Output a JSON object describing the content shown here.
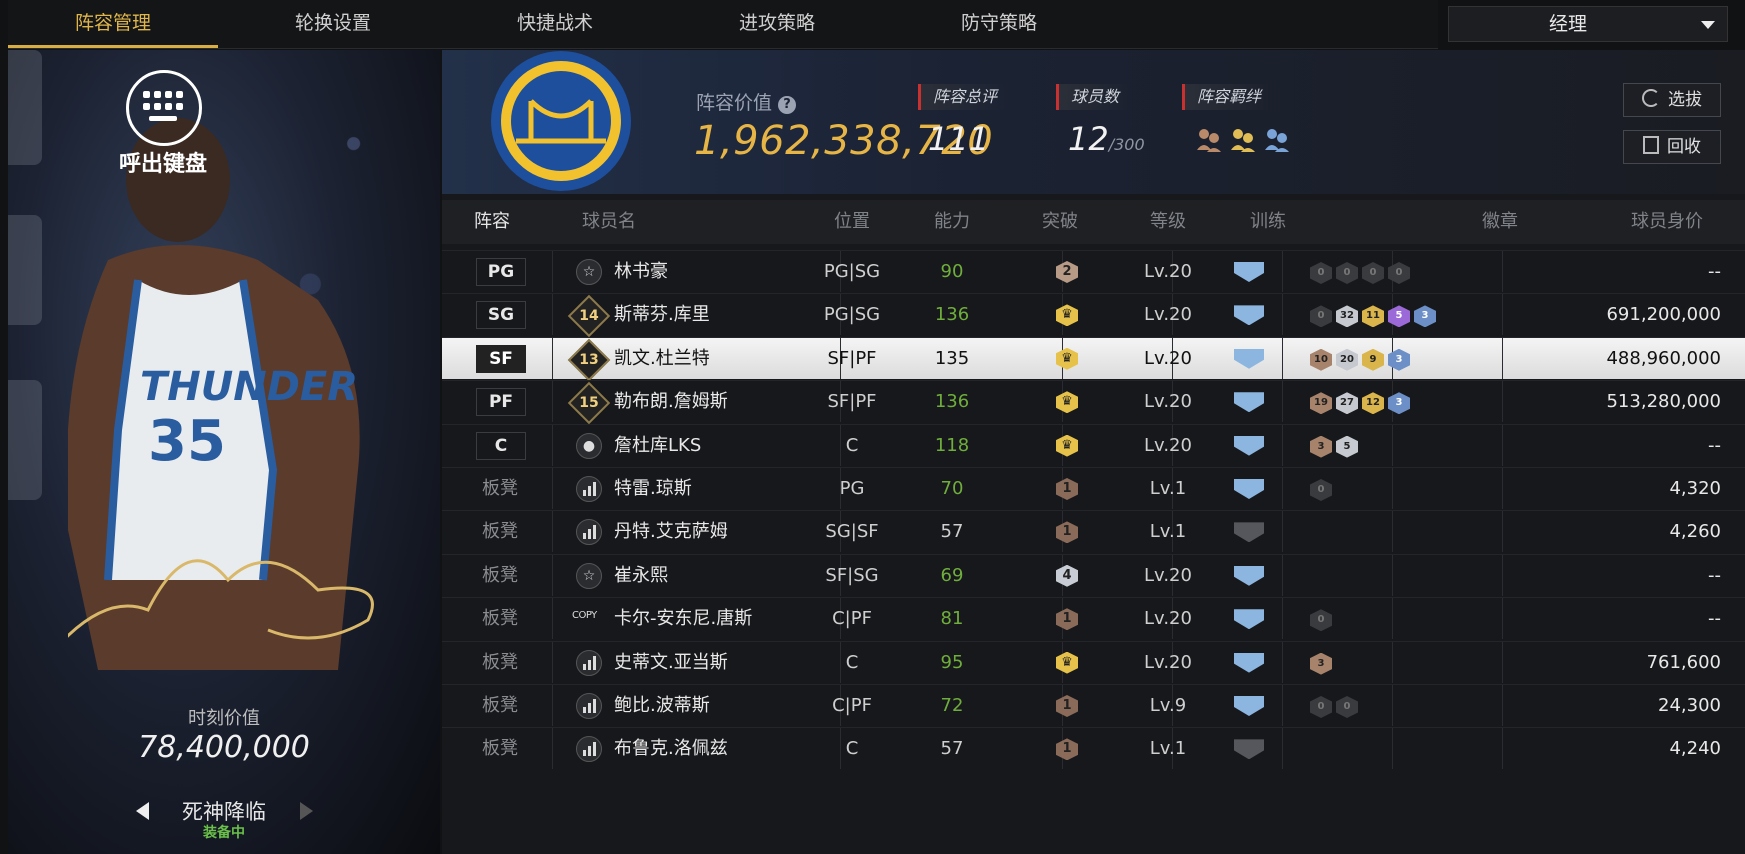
{
  "tabs": [
    "阵容管理",
    "轮换设置",
    "快捷战术",
    "进攻策略",
    "防守策略"
  ],
  "manager_select": "经理",
  "left_panel": {
    "keyboard_label": "呼出键盘",
    "moment_value_label": "时刻价值",
    "moment_value": "78,400,000",
    "skill_name": "死神降临",
    "skill_status": "装备中"
  },
  "header": {
    "value_label": "阵容价值",
    "value_help": "?",
    "value": "1,962,338,720",
    "rating_label": "阵容总评",
    "rating": "111",
    "players_label": "球员数",
    "players": "12",
    "players_max": "/300",
    "bond_label": "阵容羁绊",
    "select_button": "选拔",
    "recycle_button": "回收"
  },
  "columns": [
    "阵容",
    "球员名",
    "位置",
    "能力",
    "突破",
    "等级",
    "训练",
    "徽章",
    "球员身价"
  ],
  "rows": [
    {
      "slot": "PG",
      "bench": false,
      "icon": "star",
      "name": "林书豪",
      "pos": "PG|SG",
      "ability": "90",
      "green": true,
      "breakthrough": "2",
      "bk": "b2",
      "level": "Lv.20",
      "train": true,
      "badges": [
        [
          "0",
          "e"
        ],
        [
          "0",
          "e"
        ],
        [
          "0",
          "e"
        ],
        [
          "0",
          "e"
        ]
      ],
      "price": "--"
    },
    {
      "slot": "SG",
      "bench": false,
      "icon": "num",
      "num": "14",
      "name": "斯蒂芬.库里",
      "pos": "PG|SG",
      "ability": "136",
      "green": true,
      "breakthrough": "crown",
      "bk": "crown",
      "level": "Lv.20",
      "train": true,
      "badges": [
        [
          "0",
          "e"
        ],
        [
          "32",
          "sv"
        ],
        [
          "11",
          "gd"
        ],
        [
          "5",
          "pu"
        ],
        [
          "3",
          "bl"
        ]
      ],
      "price": "691,200,000"
    },
    {
      "slot": "SF",
      "bench": false,
      "selected": true,
      "icon": "num",
      "num": "13",
      "name": "凯文.杜兰特",
      "pos": "SF|PF",
      "ability": "135",
      "green": false,
      "breakthrough": "crown",
      "bk": "crown",
      "level": "Lv.20",
      "train": true,
      "badges": [
        [
          "10",
          "br"
        ],
        [
          "20",
          "sv"
        ],
        [
          "9",
          "gd"
        ],
        [
          "3",
          "bl"
        ]
      ],
      "price": "488,960,000"
    },
    {
      "slot": "PF",
      "bench": false,
      "icon": "num",
      "num": "15",
      "name": "勒布朗.詹姆斯",
      "pos": "SF|PF",
      "ability": "136",
      "green": true,
      "breakthrough": "crown",
      "bk": "crown",
      "level": "Lv.20",
      "train": true,
      "badges": [
        [
          "19",
          "br"
        ],
        [
          "27",
          "sv"
        ],
        [
          "12",
          "gd"
        ],
        [
          "3",
          "bl"
        ]
      ],
      "price": "513,280,000"
    },
    {
      "slot": "C",
      "bench": false,
      "icon": "person",
      "name": "詹杜库LKS",
      "pos": "C",
      "ability": "118",
      "green": true,
      "breakthrough": "crown",
      "bk": "crown",
      "level": "Lv.20",
      "train": true,
      "badges": [
        [
          "3",
          "br"
        ],
        [
          "5",
          "sv"
        ]
      ],
      "price": "--"
    },
    {
      "slot": "板凳",
      "bench": true,
      "icon": "bars",
      "name": "特雷.琼斯",
      "pos": "PG",
      "ability": "70",
      "green": true,
      "breakthrough": "1",
      "bk": "b1",
      "level": "Lv.1",
      "train": true,
      "badges": [
        [
          "0",
          "e"
        ]
      ],
      "price": "4,320"
    },
    {
      "slot": "板凳",
      "bench": true,
      "icon": "bars",
      "name": "丹特.艾克萨姆",
      "pos": "SG|SF",
      "ability": "57",
      "green": false,
      "breakthrough": "1",
      "bk": "b1",
      "level": "Lv.1",
      "train": false,
      "badges": [],
      "price": "4,260"
    },
    {
      "slot": "板凳",
      "bench": true,
      "icon": "star",
      "name": "崔永熙",
      "pos": "SF|SG",
      "ability": "69",
      "green": true,
      "breakthrough": "4",
      "bk": "b4",
      "level": "Lv.20",
      "train": true,
      "badges": [],
      "price": "--"
    },
    {
      "slot": "板凳",
      "bench": true,
      "icon": "copy",
      "name": "卡尔-安东尼.唐斯",
      "pos": "C|PF",
      "ability": "81",
      "green": true,
      "breakthrough": "1",
      "bk": "b1",
      "level": "Lv.20",
      "train": true,
      "badges": [
        [
          "0",
          "e"
        ]
      ],
      "price": "--"
    },
    {
      "slot": "板凳",
      "bench": true,
      "icon": "bars",
      "name": "史蒂文.亚当斯",
      "pos": "C",
      "ability": "95",
      "green": true,
      "breakthrough": "crown",
      "bk": "crown",
      "level": "Lv.20",
      "train": true,
      "badges": [
        [
          "3",
          "br"
        ]
      ],
      "price": "761,600"
    },
    {
      "slot": "板凳",
      "bench": true,
      "icon": "bars",
      "name": "鲍比.波蒂斯",
      "pos": "C|PF",
      "ability": "72",
      "green": true,
      "breakthrough": "1",
      "bk": "b1",
      "level": "Lv.9",
      "train": true,
      "badges": [
        [
          "0",
          "e"
        ],
        [
          "0",
          "e"
        ]
      ],
      "price": "24,300"
    },
    {
      "slot": "板凳",
      "bench": true,
      "icon": "bars",
      "name": "布鲁克.洛佩兹",
      "pos": "C",
      "ability": "57",
      "green": false,
      "breakthrough": "1",
      "bk": "b1",
      "level": "Lv.1",
      "train": false,
      "badges": [],
      "price": "4,240"
    }
  ],
  "colors": {
    "accent": "#e0b64a",
    "green": "#6fae3c",
    "team_blue": "#1d4f9c",
    "team_gold": "#f2c12e"
  }
}
